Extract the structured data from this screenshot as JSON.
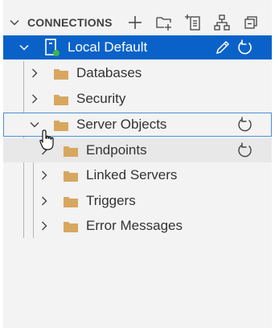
{
  "header": {
    "title": "CONNECTIONS",
    "actions": [
      {
        "name": "new-connection-icon",
        "tooltip": "New Connection"
      },
      {
        "name": "new-server-group-icon",
        "tooltip": "New Server Group"
      },
      {
        "name": "new-query-icon",
        "tooltip": "New Query"
      },
      {
        "name": "show-active-connections-icon",
        "tooltip": "Show Active Connections"
      },
      {
        "name": "collapse-all-icon",
        "tooltip": "Collapse All"
      }
    ]
  },
  "tree": {
    "server": {
      "label": "Local Default",
      "status_color": "#3cb648"
    },
    "databases": {
      "label": "Databases"
    },
    "security": {
      "label": "Security"
    },
    "server_objects": {
      "label": "Server Objects"
    },
    "endpoints": {
      "label": "Endpoints"
    },
    "linked_servers": {
      "label": "Linked Servers"
    },
    "triggers": {
      "label": "Triggers"
    },
    "error_messages": {
      "label": "Error Messages"
    }
  },
  "colors": {
    "selection": "#0a62c9",
    "folder": "#d7a760",
    "text": "#333333"
  }
}
